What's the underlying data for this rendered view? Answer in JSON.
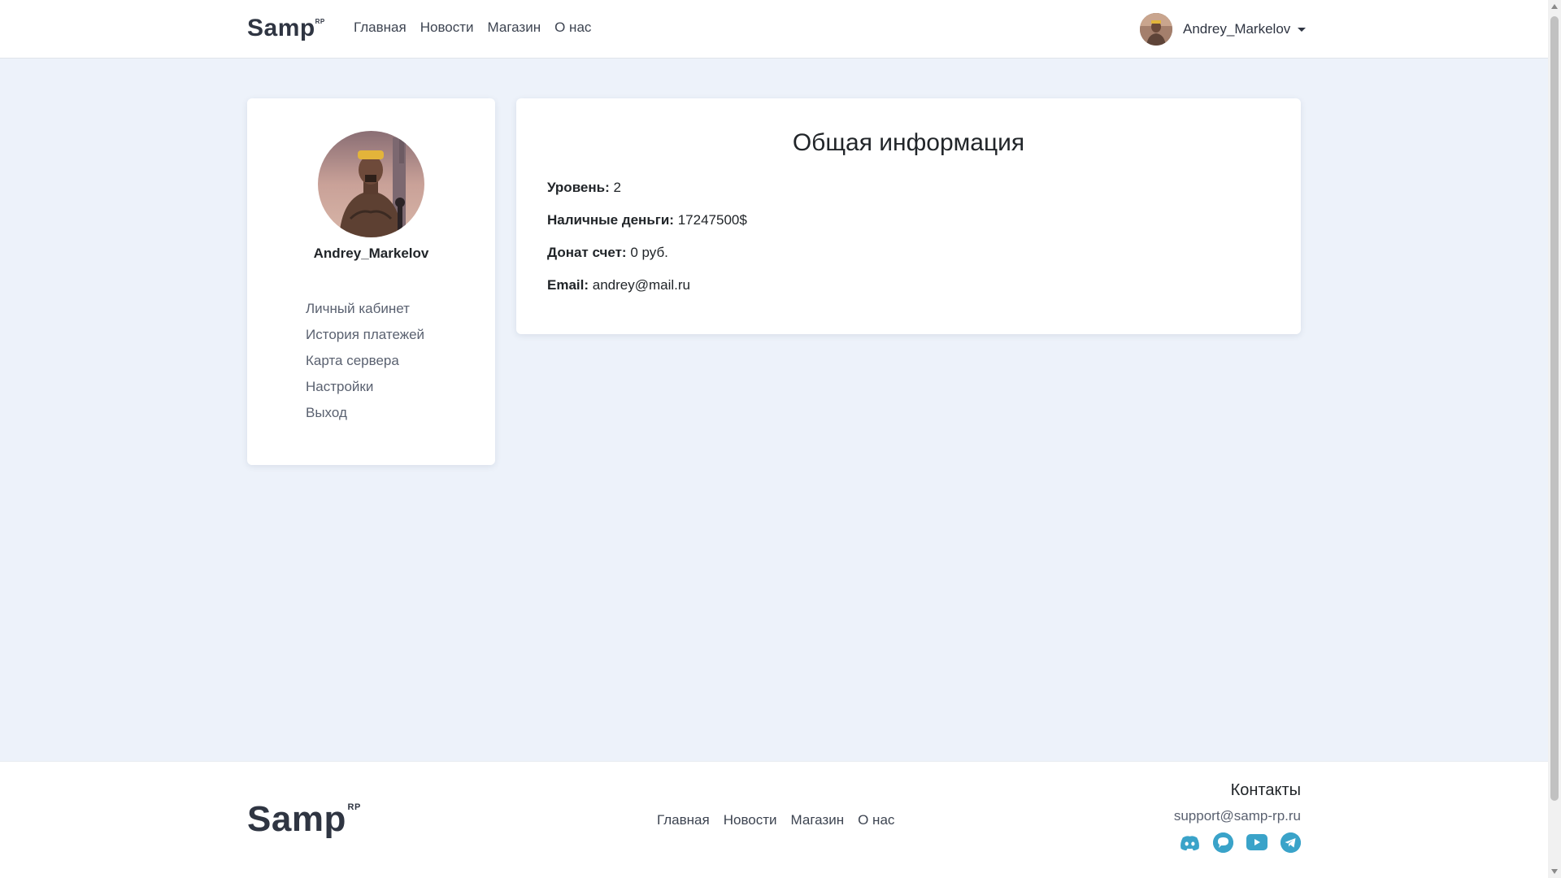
{
  "header": {
    "logo_text": "Samp",
    "logo_sup": "RP",
    "nav": [
      "Главная",
      "Новости",
      "Магазин",
      "О нас"
    ],
    "user_name": "Andrey_Markelov"
  },
  "profile": {
    "name": "Andrey_Markelov",
    "menu": [
      "Личный кабинет",
      "История платежей",
      "Карта сервера",
      "Настройки",
      "Выход"
    ]
  },
  "info": {
    "title": "Общая информация",
    "rows": [
      {
        "label": "Уровень:",
        "value": "2"
      },
      {
        "label": "Наличные деньги:",
        "value": "17247500$"
      },
      {
        "label": "Донат счет:",
        "value": "0 руб."
      },
      {
        "label": "Email:",
        "value": "andrey@mail.ru"
      }
    ]
  },
  "footer": {
    "logo_text": "Samp",
    "logo_sup": "RP",
    "nav": [
      "Главная",
      "Новости",
      "Магазин",
      "О нас"
    ],
    "contacts_title": "Контакты",
    "email": "support@samp-rp.ru",
    "socials": [
      "discord-icon",
      "chat-icon",
      "youtube-icon",
      "telegram-icon"
    ]
  },
  "colors": {
    "background": "#edf2fa",
    "accent": "#3aa3c9"
  }
}
